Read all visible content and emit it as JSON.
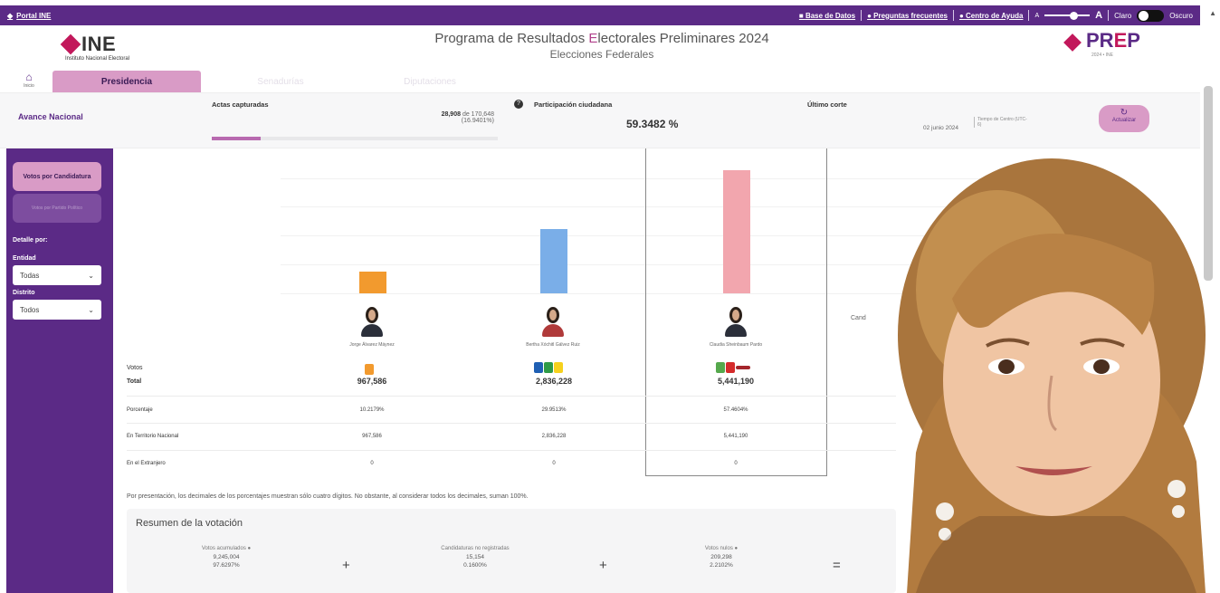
{
  "topbar": {
    "portal": "Portal INE",
    "links": [
      "Base de Datos",
      "Preguntas frecuentes",
      "Centro de Ayuda"
    ],
    "font_small": "A",
    "font_large": "A",
    "theme_light": "Claro",
    "theme_dark": "Oscuro"
  },
  "header": {
    "logo_text": "INE",
    "logo_sub": "Instituto Nacional Electoral",
    "title_pre": "Programa de Resultados ",
    "title_hl": "E",
    "title_post": "lectorales Preliminares 2024",
    "subtitle": "Elecciones Federales",
    "prep_pre": "PR",
    "prep_e": "E",
    "prep_post": "P",
    "prep_sub": "2024 • INE"
  },
  "nav": {
    "home_label": "Inicio",
    "tabs": [
      "Presidencia",
      "Senadurías",
      "Diputaciones"
    ]
  },
  "avance": {
    "title": "Avance Nacional",
    "actas_label": "Actas capturadas",
    "actas_count": "28,908",
    "actas_total": "de 170,648",
    "actas_pct": "(16.9401%)",
    "actas_progress": 0.169401,
    "participacion_label": "Participación ciudadana",
    "participacion_value": "59.3482 %",
    "corte_label": "Último corte",
    "corte_date": "02 junio 2024",
    "corte_tz": "Tiempo de Centro (UTC-6)",
    "actualizar": "Actualizar"
  },
  "sidebar": {
    "btn_candidatura": "Votos por Candidatura",
    "btn_partido": "Votos por Partido Político",
    "detalle": "Detalle por:",
    "entidad_label": "Entidad",
    "entidad_value": "Todas",
    "distrito_label": "Distrito",
    "distrito_value": "Todos"
  },
  "chart_data": {
    "type": "bar",
    "categories": [
      "Jorge Álvarez Máynez",
      "Bertha Xóchitl Gálvez Ruiz",
      "Claudia Sheinbaum Pardo"
    ],
    "values": [
      967586,
      2836228,
      5441190
    ],
    "colors": [
      "#f29a2e",
      "#7aaee8",
      "#f2a6ae"
    ],
    "ylim": [
      0,
      6000000
    ],
    "grid": true
  },
  "table": {
    "votos_label": "Votos",
    "total_label": "Total",
    "rows": [
      {
        "label": "Porcentaje",
        "values": [
          "10.2179%",
          "29.9513%",
          "57.4604%"
        ]
      },
      {
        "label": "En Territorio Nacional",
        "values": [
          "967,586",
          "2,836,228",
          "5,441,190"
        ]
      },
      {
        "label": "En el Extranjero",
        "values": [
          "0",
          "0",
          "0"
        ]
      }
    ],
    "totals": [
      "967,586",
      "2,836,228",
      "5,441,190"
    ],
    "extra_label": "Cand"
  },
  "note": "Por presentación, los decimales de los porcentajes muestran sólo cuatro dígitos. No obstante, al considerar todos los decimales, suman 100%.",
  "resumen": {
    "title": "Resumen de la votación",
    "blocks": [
      {
        "label": "Votos acumulados",
        "value": "9,245,004",
        "pct": "97.6297%"
      },
      {
        "label": "Candidaturas no registradas",
        "value": "15,154",
        "pct": "0.1600%"
      },
      {
        "label": "Votos nulos",
        "value": "209,298",
        "pct": "2.2102%"
      }
    ],
    "ops": [
      "+",
      "+",
      "="
    ]
  }
}
